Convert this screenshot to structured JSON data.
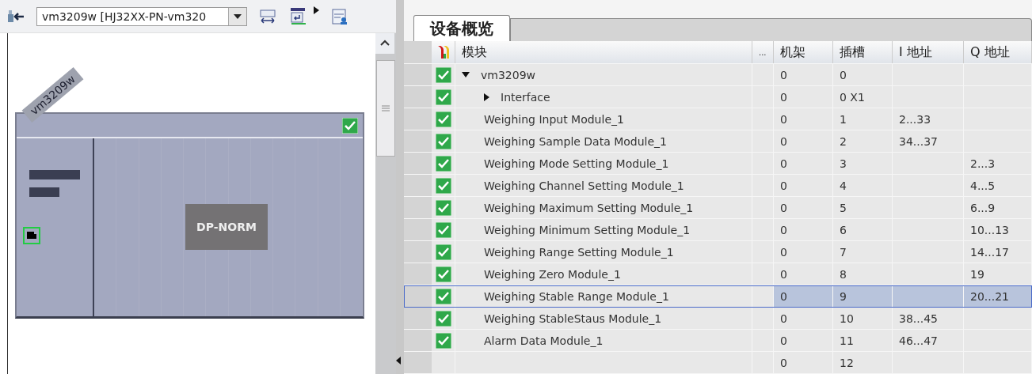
{
  "toolbar": {
    "device_select": {
      "value": "vm3209w [HJ32XX-PN-vm320"
    }
  },
  "device_view": {
    "device_label": "vm3209w",
    "ok": true,
    "module_label": "DP-NORM"
  },
  "tabs": [
    {
      "label": "设备概览",
      "selected": true
    }
  ],
  "table": {
    "columns": [
      "模块",
      "...",
      "机架",
      "插槽",
      "I 地址",
      "Q 地址"
    ],
    "rows": [
      {
        "module": "vm3209w",
        "ok": true,
        "expanded": true,
        "selected": false,
        "rack": "0",
        "slot": "0",
        "children": [
          {
            "module": "Interface",
            "ok": true,
            "expanded": false,
            "selected": false,
            "rack": "0",
            "slot": "0 X1"
          },
          {
            "module": "Weighing Input Module_1",
            "ok": true,
            "selected": false,
            "rack": "0",
            "slot": "1",
            "i_address": "2...33"
          },
          {
            "module": "Weighing Sample Data Module_1",
            "ok": true,
            "selected": false,
            "rack": "0",
            "slot": "2",
            "i_address": "34...37"
          },
          {
            "module": "Weighing Mode Setting Module_1",
            "ok": true,
            "selected": false,
            "rack": "0",
            "slot": "3",
            "q_address": "2...3"
          },
          {
            "module": "Weighing Channel Setting Module_1",
            "ok": true,
            "selected": false,
            "rack": "0",
            "slot": "4",
            "q_address": "4...5"
          },
          {
            "module": "Weighing Maximum Setting Module_1",
            "ok": true,
            "selected": false,
            "rack": "0",
            "slot": "5",
            "q_address": "6...9"
          },
          {
            "module": "Weighing Minimum Setting Module_1",
            "ok": true,
            "selected": false,
            "rack": "0",
            "slot": "6",
            "q_address": "10...13"
          },
          {
            "module": "Weighing Range Setting Module_1",
            "ok": true,
            "selected": false,
            "rack": "0",
            "slot": "7",
            "q_address": "14...17"
          },
          {
            "module": "Weighing Zero Module_1",
            "ok": true,
            "selected": false,
            "rack": "0",
            "slot": "8",
            "q_address": "19"
          },
          {
            "module": "Weighing Stable Range Module_1",
            "ok": true,
            "selected": true,
            "rack": "0",
            "slot": "9",
            "q_address": "20...21"
          },
          {
            "module": "Weighing StableStaus Module_1",
            "ok": true,
            "selected": false,
            "rack": "0",
            "slot": "10",
            "i_address": "38...45"
          },
          {
            "module": "Alarm Data Module_1",
            "ok": true,
            "selected": false,
            "rack": "0",
            "slot": "11",
            "i_address": "46...47"
          },
          {
            "ok": false,
            "selected": false,
            "rack": "0",
            "slot": "12"
          }
        ]
      }
    ]
  }
}
